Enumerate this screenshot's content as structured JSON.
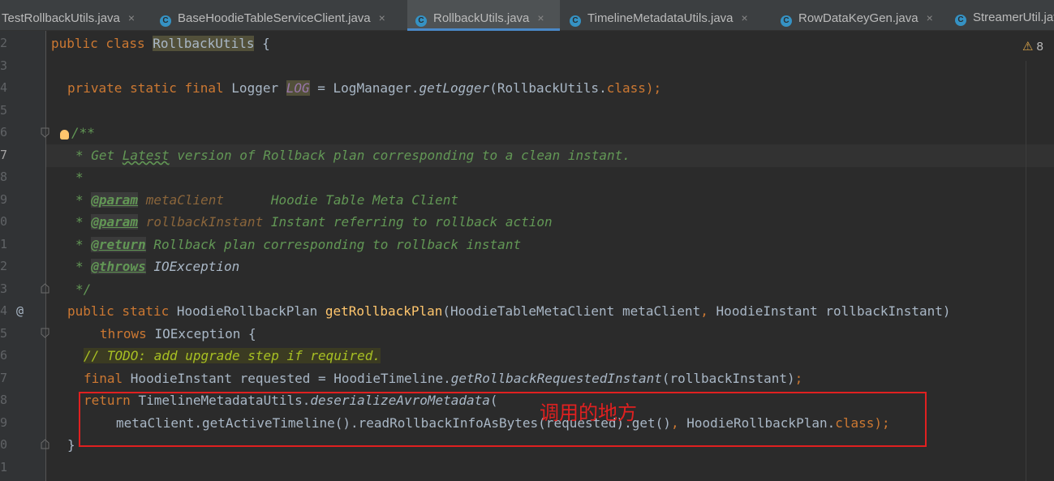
{
  "tabs": [
    {
      "label": "TestRollbackUtils.java",
      "active": false
    },
    {
      "label": "BaseHoodieTableServiceClient.java",
      "active": false
    },
    {
      "label": "RollbackUtils.java",
      "active": true
    },
    {
      "label": "TimelineMetadataUtils.java",
      "active": false
    },
    {
      "label": "RowDataKeyGen.java",
      "active": false
    },
    {
      "label": "StreamerUtil.java",
      "active": false
    }
  ],
  "tab_close_glyph": "×",
  "tab_icon_letter": "C",
  "inspection": {
    "icon": "warning-triangle-icon",
    "glyph": "⚠",
    "count": "8"
  },
  "gutter": {
    "line_numbers": [
      "2",
      "3",
      "4",
      "5",
      "6",
      "7",
      "8",
      "9",
      "0",
      "1",
      "2",
      "3",
      "4",
      "5",
      "6",
      "7",
      "8",
      "9",
      "0",
      "1"
    ],
    "override_marker": "@"
  },
  "code": {
    "l2": [
      "public class ",
      "RollbackUtils",
      " {"
    ],
    "l4": [
      "private static final ",
      "Logger ",
      "LOG",
      " = LogManager.",
      "getLogger",
      "(RollbackUtils.",
      "class",
      ");"
    ],
    "l6": "/**",
    "l7": [
      "* Get ",
      "Latest",
      " version of Rollback plan corresponding to a clean instant."
    ],
    "l8": "*",
    "l9": [
      "* ",
      "@param",
      " ",
      "metaClient",
      "      Hoodie Table Meta Client"
    ],
    "l10": [
      "* ",
      "@param",
      " ",
      "rollbackInstant",
      " Instant referring to rollback action"
    ],
    "l11": [
      "* ",
      "@return",
      " Rollback plan corresponding to rollback instant"
    ],
    "l12": [
      "* ",
      "@throws",
      " ",
      "IOException"
    ],
    "l13": "*/",
    "l14": [
      "public static ",
      "HoodieRollbackPlan ",
      "getRollbackPlan",
      "(HoodieTableMetaClient metaClient",
      ", ",
      "HoodieInstant rollbackInstant)"
    ],
    "l15": [
      "throws ",
      "IOException {"
    ],
    "l16": "// TODO: add upgrade step if required.",
    "l17": [
      "final ",
      "HoodieInstant requested = HoodieTimeline.",
      "getRollbackRequestedInstant",
      "(rollbackInstant)",
      ";"
    ],
    "l18": [
      "return ",
      "TimelineMetadataUtils.",
      "deserializeAvroMetadata",
      "("
    ],
    "l19": [
      "metaClient.getActiveTimeline().readRollbackInfoAsBytes(requested).get()",
      ", ",
      "HoodieRollbackPlan.",
      "class",
      ");"
    ],
    "l20": "}"
  },
  "annotation": {
    "text": "调用的地方",
    "color": "#e02020"
  },
  "colors": {
    "keyword": "#cc7832",
    "method": "#ffc66d",
    "doc": "#629755",
    "todo": "#a8c023",
    "field": "#9876aa",
    "text": "#a9b7c6",
    "accent": "#4a88c7"
  }
}
